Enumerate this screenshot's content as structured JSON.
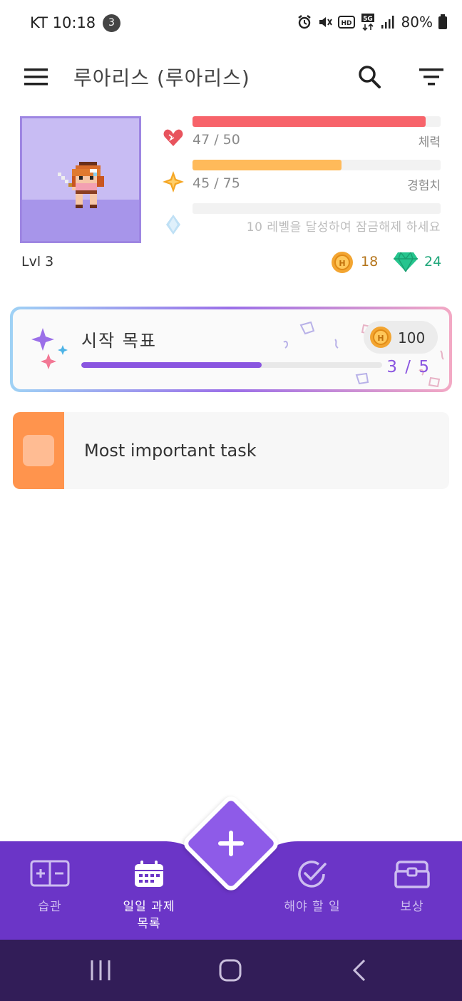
{
  "status_bar": {
    "time": "KT 10:18",
    "notification_count": "3",
    "network": "5G",
    "battery": "80%"
  },
  "app_bar": {
    "title": "루아리스 (루아리스)",
    "menu_icon": "hamburger-menu-icon",
    "search_icon": "search-icon",
    "filter_icon": "filter-icon"
  },
  "hero": {
    "level": "Lvl 3",
    "stats": {
      "health": {
        "value_text": "47 / 50",
        "label": "체력",
        "fraction": 0.94,
        "color": "#f7636a",
        "icon": "heart-icon"
      },
      "experience": {
        "value_text": "45 / 75",
        "label": "경험치",
        "fraction": 0.6,
        "color": "#ffba5a",
        "icon": "star-icon"
      },
      "mana": {
        "locked_text": "10 레벨을 달성하여 잠금해제 하세요",
        "fraction": 0,
        "icon": "diamond-icon"
      }
    },
    "currency": {
      "gold": "18",
      "gems": "24"
    }
  },
  "goal_card": {
    "title": "시작 목표",
    "reward": "100",
    "progress_text": "3 / 5",
    "progress_fraction": 0.6,
    "colors": {
      "accent": "#8a55e0"
    }
  },
  "task": {
    "title": "Most important task",
    "color": "#ff944d"
  },
  "bottom_nav": {
    "items": [
      {
        "label": "습관",
        "icon": "habits-icon"
      },
      {
        "label": "일일 과제 목록",
        "icon": "calendar-icon",
        "active": true
      },
      {
        "label": "해야 할 일",
        "icon": "checkmark-icon"
      },
      {
        "label": "보상",
        "icon": "treasure-chest-icon"
      }
    ],
    "add_icon": "plus-icon",
    "background": "#6b35c7"
  }
}
